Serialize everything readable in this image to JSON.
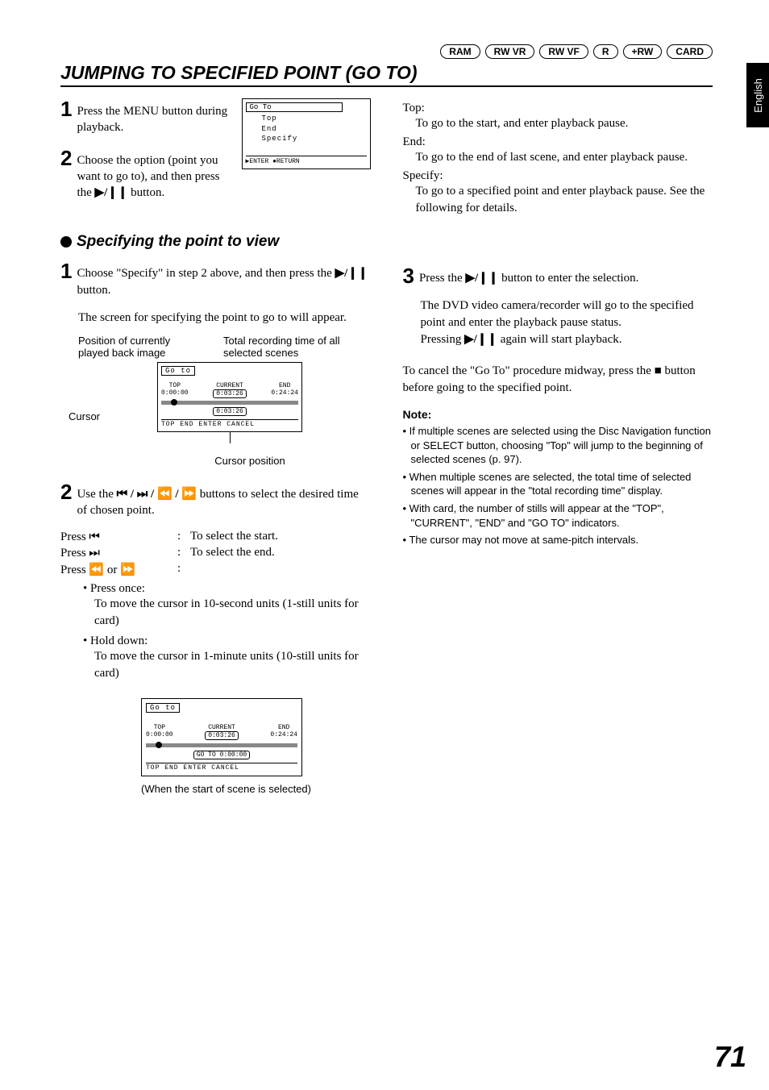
{
  "badges": [
    "RAM",
    "RW VR",
    "RW VF",
    "R",
    "+RW",
    "CARD"
  ],
  "side_tab": "English",
  "h1": "JUMPING TO SPECIFIED POINT (GO TO)",
  "left": {
    "step1": "Press the MENU button during playback.",
    "step2_a": "Choose the option (point you want to go to), and then press the ",
    "step2_b": " button.",
    "h2": "Specifying the point to view",
    "sp_step1_a": "Choose \"Specify\" in step 2 above, and then press the ",
    "sp_step1_b": " button.",
    "sp_step1_c": "The screen for specifying the point to go to will appear.",
    "lbl_pos": "Position of currently played back image",
    "lbl_total": "Total recording time of all selected scenes",
    "lbl_cursor": "Cursor",
    "lbl_cursor_pos": "Cursor position",
    "sp_step2_a": "Use the ",
    "sp_step2_b": " buttons to select the desired time of chosen point.",
    "press_prev_k": "Press ⏮",
    "press_prev_v": "To select the start.",
    "press_next_k": "Press ⏭",
    "press_next_v": "To select the end.",
    "press_rw_k": "Press ⏪ or ⏩",
    "sub_once": "• Press once:",
    "sub_once_d": "To move the cursor in 10-second units (1-still units for card)",
    "sub_hold": "• Hold down:",
    "sub_hold_d": "To move the cursor in 1-minute units (10-still units for card)",
    "fig3_caption": "(When the start of scene is selected)"
  },
  "right": {
    "top_k": "Top:",
    "top_v": "To go to the start, and enter playback pause.",
    "end_k": "End:",
    "end_v": "To go to the end of last scene, and enter playback pause.",
    "spec_k": "Specify:",
    "spec_v": "To go to a specified point and enter playback pause. See the following for details.",
    "step3_a": "Press the ",
    "step3_b": " button to enter the selection.",
    "step3_c": "The DVD video camera/recorder will go to the specified point and enter the playback pause status.",
    "step3_d_a": "Pressing ",
    "step3_d_b": " again will start playback.",
    "cancel_a": "To cancel the \"Go To\" procedure midway, press the ",
    "cancel_b": " button before going to the specified point.",
    "note_head": "Note:",
    "notes": [
      "If multiple scenes are selected using the Disc Navigation function or SELECT button, choosing \"Top\" will jump to the beginning of selected scenes (p. 97).",
      "When multiple scenes are selected, the total time of selected scenes will appear in the \"total recording time\" display.",
      "With card, the number of stills will appear at the \"TOP\", \"CURRENT\", \"END\" and \"GO TO\" indicators.",
      "The cursor may not move at same-pitch intervals."
    ]
  },
  "fig1": {
    "title": "Go To",
    "items": [
      "Top",
      "End",
      "Specify"
    ],
    "bot_l": "▶ENTER ●RETURN",
    "bot_r": ""
  },
  "fig2": {
    "title": "Go to",
    "top_l": "TOP",
    "top_v": "0:00:00",
    "cur_l": "CURRENT",
    "cur_v": "0:03:26",
    "end_l": "END",
    "end_v": "0:24:24",
    "below": "0:03:26",
    "bot": "TOP  END  ENTER  CANCEL"
  },
  "fig3": {
    "title": "Go to",
    "top_l": "TOP",
    "top_v": "0:00:00",
    "cur_l": "CURRENT",
    "cur_v": "0:03:26",
    "end_l": "END",
    "end_v": "0:24:24",
    "goto": "GO TO 0:00:00",
    "bot": "TOP  END  ENTER  CANCEL"
  },
  "icons": {
    "play_pause": "▶/❙❙",
    "nav_combo": "⏮ / ⏭ / ⏪ / ⏩",
    "stop": "■"
  },
  "pagenum": "71"
}
